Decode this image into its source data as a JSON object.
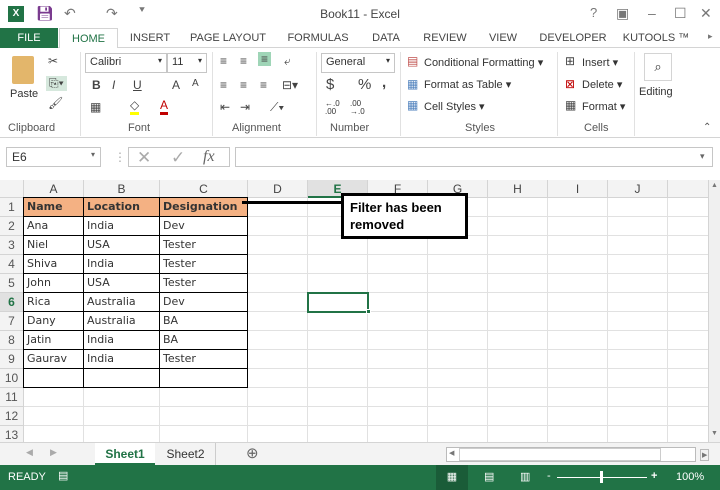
{
  "window": {
    "title": "Book11 - Excel",
    "help": "?",
    "restore": "▣",
    "minimize": "–",
    "maximize": "☐",
    "close": "✕"
  },
  "tabs": [
    "FILE",
    "HOME",
    "INSERT",
    "PAGE LAYOUT",
    "FORMULAS",
    "DATA",
    "REVIEW",
    "VIEW",
    "DEVELOPER",
    "KUTOOLS ™"
  ],
  "ribbon": {
    "clipboard": {
      "paste": "Paste",
      "label": "Clipboard"
    },
    "font": {
      "name": "Calibri",
      "size": "11",
      "bold": "B",
      "italic": "I",
      "underline": "U",
      "grow": "A",
      "shrink": "A",
      "label": "Font"
    },
    "alignment": {
      "label": "Alignment"
    },
    "number": {
      "format": "General",
      "currency": "$",
      "percent": "%",
      "comma": ",",
      "inc": "←.0 .00",
      "dec": ".00 →.0",
      "label": "Number"
    },
    "styles": {
      "conditional": "Conditional Formatting",
      "table": "Format as Table",
      "cell": "Cell Styles",
      "label": "Styles"
    },
    "cells": {
      "insert": "Insert",
      "delete": "Delete",
      "format": "Format",
      "label": "Cells"
    },
    "editing": {
      "label": "Editing"
    }
  },
  "formula_bar": {
    "name_box": "E6",
    "value": "",
    "fx": "fx"
  },
  "columns": [
    "A",
    "B",
    "C",
    "D",
    "E",
    "F",
    "G",
    "H",
    "I",
    "J"
  ],
  "rows": [
    "1",
    "2",
    "3",
    "4",
    "5",
    "6",
    "7",
    "8",
    "9",
    "10",
    "11",
    "12",
    "13"
  ],
  "table": [
    [
      "Name",
      "Location",
      "Designation"
    ],
    [
      "Ana",
      "India",
      "Dev"
    ],
    [
      "Niel",
      "USA",
      "Tester"
    ],
    [
      "Shiva",
      "India",
      "Tester"
    ],
    [
      "John",
      "USA",
      "Tester"
    ],
    [
      "Rica",
      "Australia",
      "Dev"
    ],
    [
      "Dany",
      "Australia",
      "BA"
    ],
    [
      "Jatin",
      "India",
      "BA"
    ],
    [
      "Gaurav",
      "India",
      "Tester"
    ],
    [
      "",
      "",
      ""
    ]
  ],
  "callout": "Filter has been removed",
  "sheets": [
    "Sheet1",
    "Sheet2"
  ],
  "add_sheet": "⊕",
  "status": {
    "mode": "READY",
    "zoom": "100%"
  },
  "colors": {
    "accent": "#217346",
    "header_fill": "#f4b183"
  }
}
